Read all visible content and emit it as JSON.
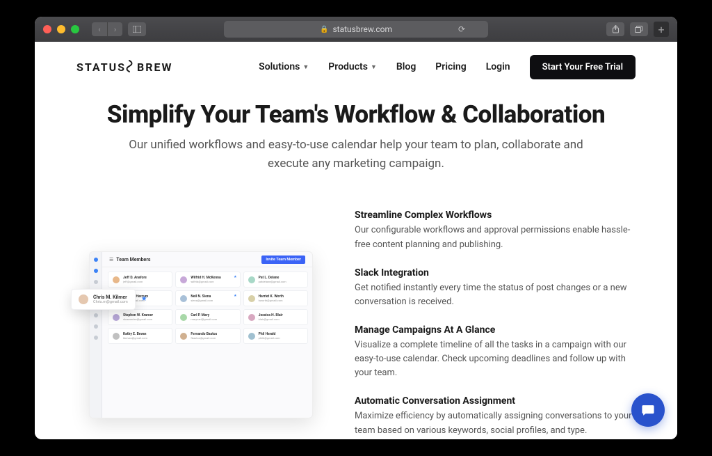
{
  "browser": {
    "url": "statusbrew.com"
  },
  "logo": {
    "left": "STATUS",
    "right": "BREW"
  },
  "nav": {
    "solutions": "Solutions",
    "products": "Products",
    "blog": "Blog",
    "pricing": "Pricing",
    "login": "Login",
    "cta": "Start Your Free Trial"
  },
  "hero": {
    "title": "Simplify Your Team's Workflow & Collaboration",
    "subtitle": "Our unified workflows and easy-to-use calendar help your team to plan, collaborate and execute any marketing campaign."
  },
  "features": [
    {
      "title": "Streamline Complex Workflows",
      "body": "Our configurable workflows and approval permissions enable hassle-free content planning and publishing."
    },
    {
      "title": "Slack Integration",
      "body": "Get notified instantly every time the status of post changes or a new conversation is received."
    },
    {
      "title": "Manage Campaigns At A Glance",
      "body": "Visualize a complete timeline of all the tasks in a campaign with our easy-to-use calendar. Check upcoming deadlines and follow up with your team."
    },
    {
      "title": "Automatic Conversation Assignment",
      "body": "Maximize efficiency by automatically assigning conversations to your team based on various keywords, social profiles, and type."
    }
  ],
  "mock": {
    "panel_title": "Team Members",
    "invite_label": "Invite Team Member",
    "float": {
      "name": "Chris M. Kilmer",
      "email": "Chris.m@gmail.com"
    },
    "members": [
      {
        "name": "Jeff D. Anafore",
        "email": "jeff@gmail.com"
      },
      {
        "name": "Wilfrid H. McKenna",
        "email": "wilfrid@gmail.com"
      },
      {
        "name": "Pat L. Delane",
        "email": "patdelane@gmail.com"
      },
      {
        "name": "Abby S. Harcum",
        "email": "abby@gmail.com"
      },
      {
        "name": "Neil N. Siena",
        "email": "siena@gmail.com"
      },
      {
        "name": "Harriet K. Worth",
        "email": "hworth@gmail.com"
      },
      {
        "name": "Stephen W. Kramer",
        "email": "skramerlee@gmail.com"
      },
      {
        "name": "Carl P. Mary",
        "email": "marycarl@gmail.com"
      },
      {
        "name": "Jessica H. Blair",
        "email": "blair@gmail.com"
      },
      {
        "name": "Kathy E. Bevan",
        "email": "kbevan@gmail.com"
      },
      {
        "name": "Fernando Bastos",
        "email": "fbastos@gmail.com"
      },
      {
        "name": "Phil Herald",
        "email": "philh@gmail.com"
      }
    ]
  }
}
